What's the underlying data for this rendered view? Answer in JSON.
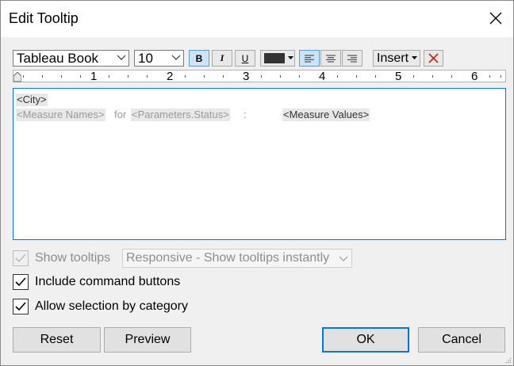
{
  "window": {
    "title": "Edit Tooltip"
  },
  "toolbar": {
    "font": "Tableau Book",
    "size": "10",
    "bold": "B",
    "italic": "I",
    "underline": "U",
    "text_color": "#333333",
    "insert": "Insert"
  },
  "ruler": {
    "marks": [
      "1",
      "2",
      "3",
      "4",
      "5",
      "6"
    ]
  },
  "editor": {
    "line1": {
      "field": "<City>"
    },
    "line2": {
      "field1": "<Measure Names>",
      "text": "for",
      "field2": "<Parameters.Status>",
      "colon": ":",
      "field3": "<Measure Values>"
    }
  },
  "options": {
    "show_tooltips": {
      "label": "Show tooltips",
      "checked": true,
      "disabled": true
    },
    "tooltip_mode": "Responsive - Show tooltips instantly",
    "include_command_buttons": {
      "label": "Include command buttons",
      "checked": true
    },
    "allow_selection": {
      "label": "Allow selection by category",
      "checked": true
    }
  },
  "buttons": {
    "reset": "Reset",
    "preview": "Preview",
    "ok": "OK",
    "cancel": "Cancel"
  }
}
